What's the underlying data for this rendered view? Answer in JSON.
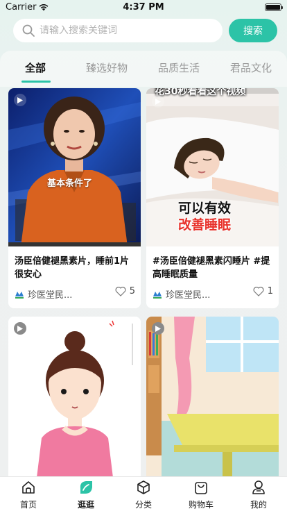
{
  "status_bar": {
    "carrier": "Carrier",
    "time": "4:37 PM"
  },
  "search": {
    "placeholder": "请输入搜索关键词",
    "button_label": "搜索"
  },
  "tabs": [
    {
      "label": "全部",
      "active": true
    },
    {
      "label": "臻选好物",
      "active": false
    },
    {
      "label": "品质生活",
      "active": false
    },
    {
      "label": "君品文化",
      "active": false
    }
  ],
  "feed": [
    {
      "overlay_text": "基本条件了",
      "title": "汤臣倍健褪黑素片，睡前1片很安心",
      "author": "珍医堂民...",
      "likes": "5"
    },
    {
      "overlay_top": "花30秒看看这个视频",
      "overlay_line1": "可以有效",
      "overlay_line2": "改善睡眠",
      "title": "#汤臣倍健褪黑素闪睡片 #提高睡眠质量",
      "author": "珍医堂民...",
      "likes": "1"
    },
    {
      "title": "",
      "author": "",
      "likes": ""
    },
    {
      "title": "",
      "author": "",
      "likes": ""
    }
  ],
  "bottom_nav": [
    {
      "label": "首页",
      "icon": "home-icon",
      "active": false
    },
    {
      "label": "逛逛",
      "icon": "explore-icon",
      "active": true
    },
    {
      "label": "分类",
      "icon": "category-icon",
      "active": false
    },
    {
      "label": "购物车",
      "icon": "cart-icon",
      "active": false
    },
    {
      "label": "我的",
      "icon": "profile-icon",
      "active": false
    }
  ],
  "colors": {
    "accent": "#2cc3a7",
    "nav_active": "#2cc3a7"
  }
}
